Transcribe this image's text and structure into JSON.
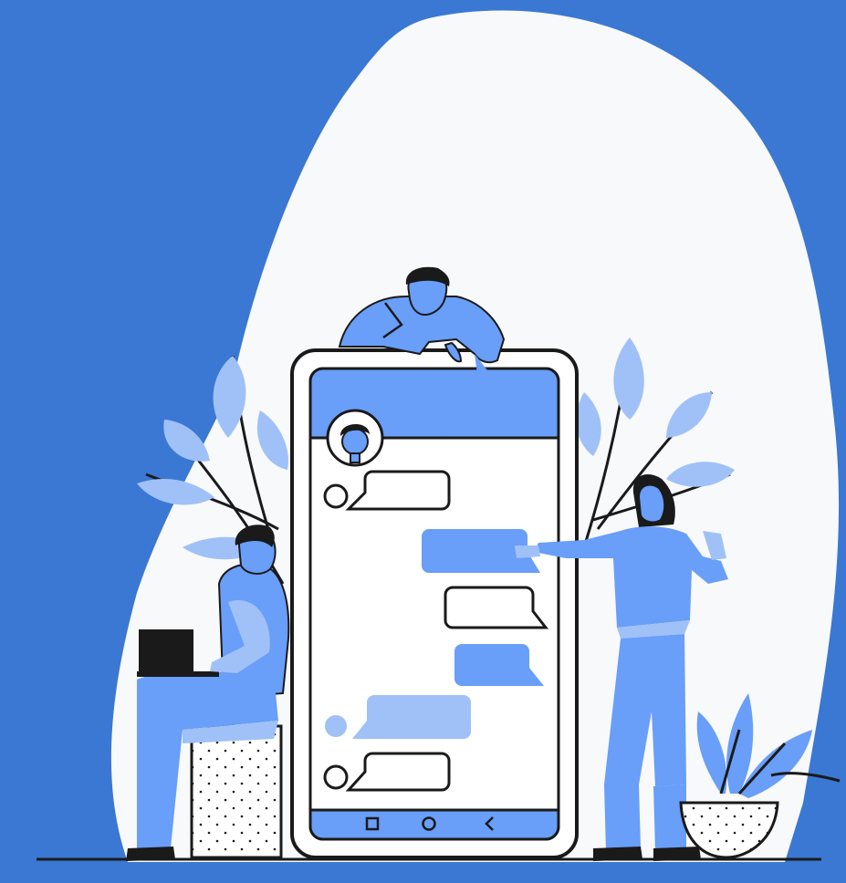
{
  "illustration": {
    "subject": "people-chatting-around-giant-smartphone",
    "icons": {
      "recent_apps": "square-icon",
      "home": "circle-icon",
      "back": "chevron-left-icon"
    },
    "colors": {
      "background": "#3a78d3",
      "blob": "#f8f9fa",
      "accent_blue": "#699ef9",
      "light_blue": "#9fc1f7",
      "outline": "#1a1a1a",
      "white": "#ffffff"
    }
  },
  "phone": {
    "messages": [
      {
        "side": "left",
        "style": "outline",
        "avatar": true
      },
      {
        "side": "right",
        "style": "filled"
      },
      {
        "side": "right",
        "style": "outline"
      },
      {
        "side": "right",
        "style": "filled"
      },
      {
        "side": "left",
        "style": "light",
        "avatar": true
      },
      {
        "side": "left",
        "style": "outline",
        "avatar": true
      }
    ]
  }
}
